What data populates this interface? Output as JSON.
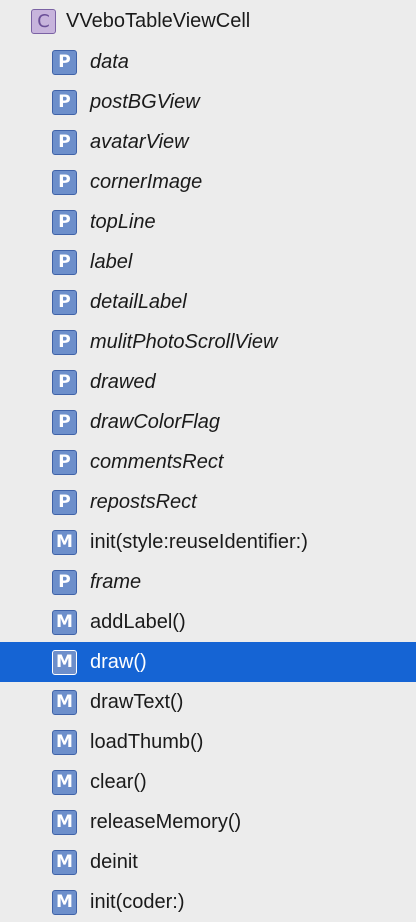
{
  "root": {
    "kind_badge": "C",
    "name": "VVeboTableViewCell"
  },
  "badges": {
    "property": "P",
    "method": "M"
  },
  "colors": {
    "selection": "#1564d4",
    "badge_blue": "#6d8fcb",
    "class_badge": "#c7b4dc",
    "background": "#ececec"
  },
  "members": [
    {
      "kind": "property",
      "label": "data",
      "selected": false
    },
    {
      "kind": "property",
      "label": "postBGView",
      "selected": false
    },
    {
      "kind": "property",
      "label": "avatarView",
      "selected": false
    },
    {
      "kind": "property",
      "label": "cornerImage",
      "selected": false
    },
    {
      "kind": "property",
      "label": "topLine",
      "selected": false
    },
    {
      "kind": "property",
      "label": "label",
      "selected": false
    },
    {
      "kind": "property",
      "label": "detailLabel",
      "selected": false
    },
    {
      "kind": "property",
      "label": "mulitPhotoScrollView",
      "selected": false
    },
    {
      "kind": "property",
      "label": "drawed",
      "selected": false
    },
    {
      "kind": "property",
      "label": "drawColorFlag",
      "selected": false
    },
    {
      "kind": "property",
      "label": "commentsRect",
      "selected": false
    },
    {
      "kind": "property",
      "label": "repostsRect",
      "selected": false
    },
    {
      "kind": "method",
      "label": "init(style:reuseIdentifier:)",
      "selected": false
    },
    {
      "kind": "property",
      "label": "frame",
      "selected": false
    },
    {
      "kind": "method",
      "label": "addLabel()",
      "selected": false
    },
    {
      "kind": "method",
      "label": "draw()",
      "selected": true
    },
    {
      "kind": "method",
      "label": "drawText()",
      "selected": false
    },
    {
      "kind": "method",
      "label": "loadThumb()",
      "selected": false
    },
    {
      "kind": "method",
      "label": "clear()",
      "selected": false
    },
    {
      "kind": "method",
      "label": "releaseMemory()",
      "selected": false
    },
    {
      "kind": "method",
      "label": "deinit",
      "selected": false
    },
    {
      "kind": "method",
      "label": "init(coder:)",
      "selected": false
    }
  ]
}
